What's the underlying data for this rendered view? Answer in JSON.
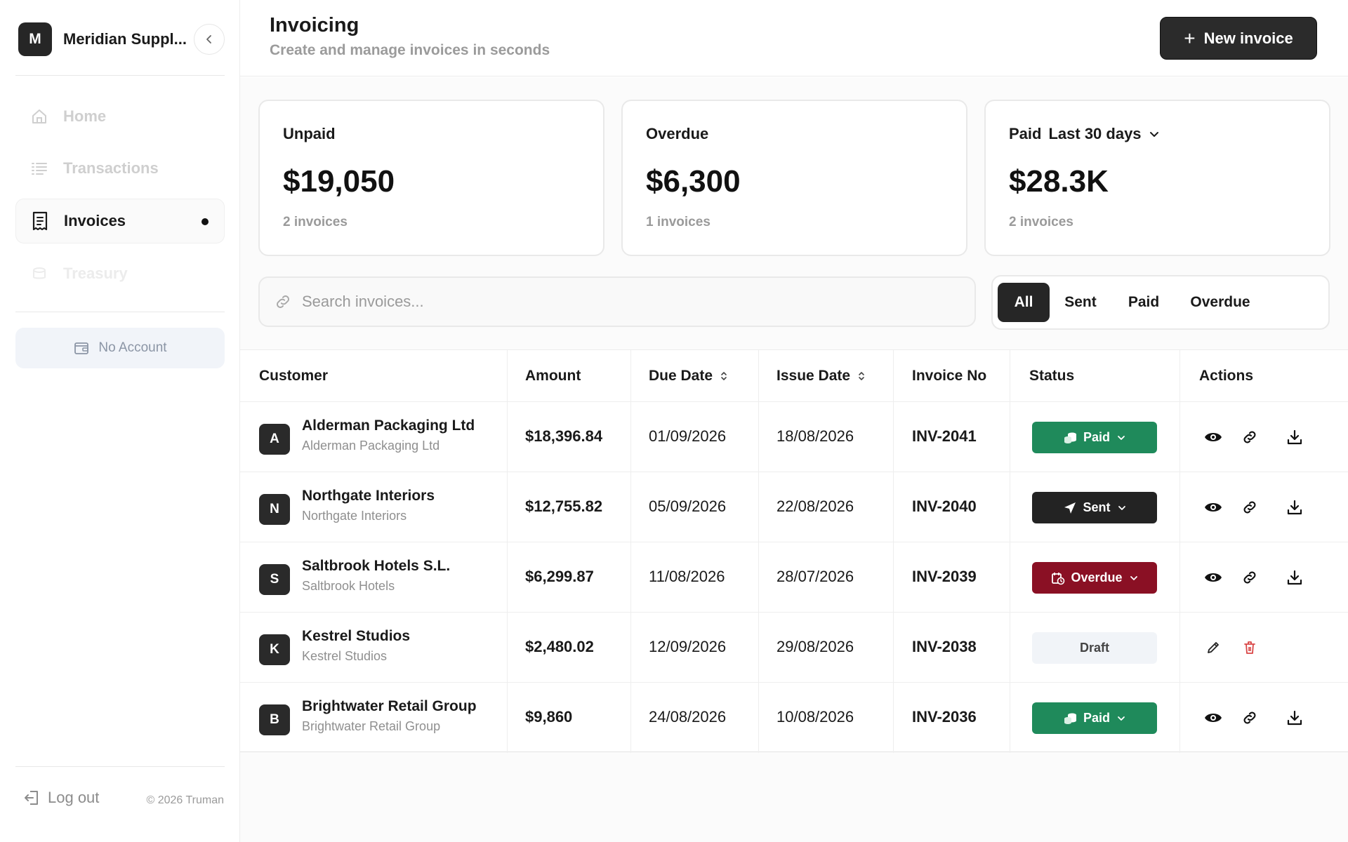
{
  "sidebar": {
    "brand_initial": "M",
    "brand_name": "Meridian Suppl...",
    "nav": [
      {
        "label": "Home",
        "icon": "home-icon"
      },
      {
        "label": "Transactions",
        "icon": "list-icon"
      },
      {
        "label": "Invoices",
        "icon": "receipt-icon"
      },
      {
        "label": "Treasury",
        "icon": "coins-icon"
      }
    ],
    "no_account_label": "No Account",
    "logout_label": "Log out",
    "copyright": "© 2026 Truman"
  },
  "header": {
    "title": "Invoicing",
    "subtitle": "Create and manage invoices in seconds",
    "new_invoice_label": "New invoice"
  },
  "summary": [
    {
      "label": "Unpaid",
      "value": "$19,050",
      "sub": "2 invoices"
    },
    {
      "label": "Overdue",
      "value": "$6,300",
      "sub": "1 invoices"
    },
    {
      "label": "Paid",
      "period": "Last 30 days",
      "value": "$28.3K",
      "sub": "2 invoices"
    }
  ],
  "search": {
    "placeholder": "Search invoices..."
  },
  "filters": [
    "All",
    "Sent",
    "Paid",
    "Overdue"
  ],
  "filter_active": "All",
  "table": {
    "columns": [
      "Customer",
      "Amount",
      "Due Date",
      "Issue Date",
      "Invoice No",
      "Status",
      "Actions"
    ],
    "rows": [
      {
        "initial": "A",
        "customer": "Alderman Packaging Ltd",
        "customer_sub": "Alderman Packaging Ltd",
        "amount": "$18,396.84",
        "due": "01/09/2026",
        "issue": "18/08/2026",
        "number": "INV-2041",
        "status": "Paid"
      },
      {
        "initial": "N",
        "customer": "Northgate Interiors",
        "customer_sub": "Northgate Interiors",
        "amount": "$12,755.82",
        "due": "05/09/2026",
        "issue": "22/08/2026",
        "number": "INV-2040",
        "status": "Sent"
      },
      {
        "initial": "S",
        "customer": "Saltbrook Hotels S.L.",
        "customer_sub": "Saltbrook Hotels",
        "amount": "$6,299.87",
        "due": "11/08/2026",
        "issue": "28/07/2026",
        "number": "INV-2039",
        "status": "Overdue"
      },
      {
        "initial": "K",
        "customer": "Kestrel Studios",
        "customer_sub": "Kestrel Studios",
        "amount": "$2,480.02",
        "due": "12/09/2026",
        "issue": "29/08/2026",
        "number": "INV-2038",
        "status": "Draft"
      },
      {
        "initial": "B",
        "customer": "Brightwater Retail Group",
        "customer_sub": "Brightwater Retail Group",
        "amount": "$9,860",
        "due": "24/08/2026",
        "issue": "10/08/2026",
        "number": "INV-2036",
        "status": "Paid"
      }
    ]
  },
  "colors": {
    "paid": "#1f8a5b",
    "sent": "#232323",
    "overdue": "#8a1024",
    "draft": "#f1f4f8",
    "delete": "#d94646"
  }
}
